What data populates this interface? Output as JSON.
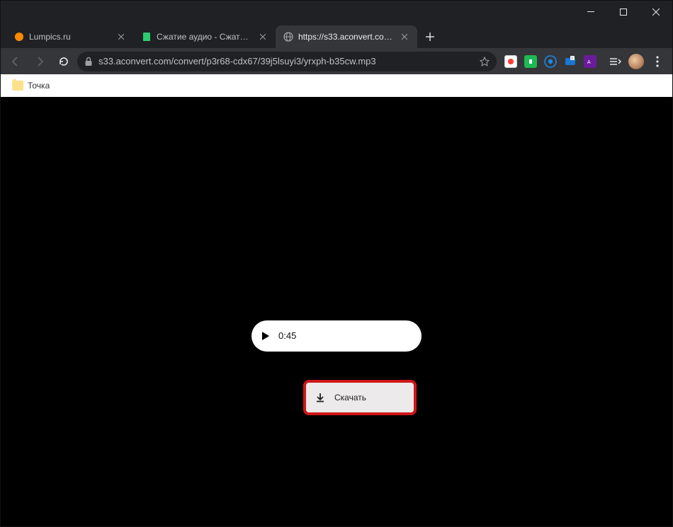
{
  "window": {
    "tabs": [
      {
        "title": "Lumpics.ru",
        "active": false,
        "favicon_color": "#ff8a00"
      },
      {
        "title": "Сжатие аудио - Сжатие файлов",
        "active": false,
        "favicon_color": "#2ecc71"
      },
      {
        "title": "https://s33.aconvert.com/convert",
        "active": true,
        "favicon_color": "#9aa0a6"
      }
    ]
  },
  "toolbar": {
    "url": "s33.aconvert.com/convert/p3r68-cdx67/39j5lsuyi3/yrxph-b35cw.mp3"
  },
  "bookmarks": {
    "items": [
      {
        "label": "Точка"
      }
    ]
  },
  "extensions": {
    "colors": [
      "#ff3b30",
      "#1db954",
      "#1e88e5",
      "#1976d2",
      "#6a1b9a"
    ]
  },
  "player": {
    "time": "0:45"
  },
  "context_menu": {
    "download_label": "Скачать"
  }
}
